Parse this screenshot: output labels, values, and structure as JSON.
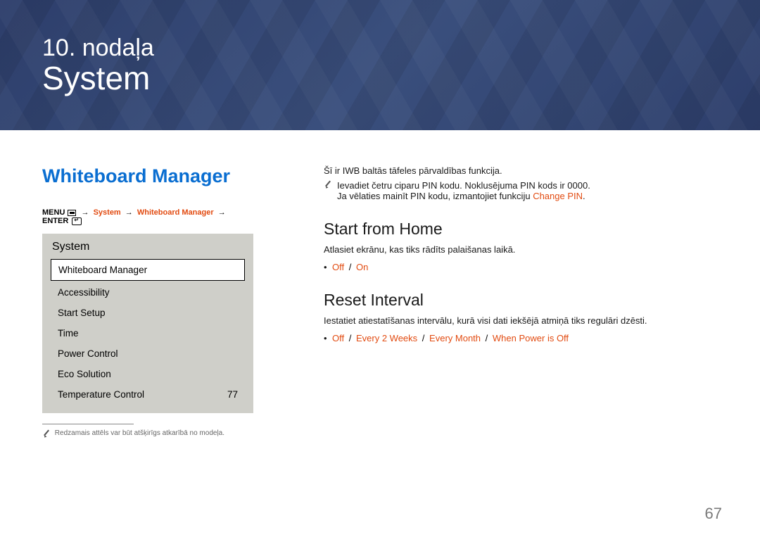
{
  "header": {
    "chapter_num": "10. nodaļa",
    "chapter_title": "System"
  },
  "left": {
    "section_title": "Whiteboard Manager",
    "breadcrumb": {
      "menu_label": "MENU",
      "seg1": "System",
      "seg2": "Whiteboard Manager",
      "enter_label": "ENTER"
    },
    "menu": {
      "header": "System",
      "items": [
        {
          "label": "Whiteboard Manager",
          "value": "",
          "selected": true
        },
        {
          "label": "Accessibility",
          "value": ""
        },
        {
          "label": "Start Setup",
          "value": ""
        },
        {
          "label": "Time",
          "value": ""
        },
        {
          "label": "Power Control",
          "value": ""
        },
        {
          "label": "Eco Solution",
          "value": ""
        },
        {
          "label": "Temperature Control",
          "value": "77"
        }
      ]
    },
    "footnote": "Redzamais attēls var būt atšķirīgs atkarībā no modeļa."
  },
  "right": {
    "intro": "Šī ir IWB baltās tāfeles pārvaldības funkcija.",
    "note_line1": "Ievadiet četru ciparu PIN kodu. Noklusējuma PIN kods ir 0000.",
    "note_line2_pre": "Ja vēlaties mainīt PIN kodu, izmantojiet funkciju ",
    "note_line2_em": "Change PIN",
    "note_line2_post": ".",
    "sub1": {
      "title": "Start from Home",
      "desc": "Atlasiet ekrānu, kas tiks rādīts palaišanas laikā.",
      "options": [
        "Off",
        "On"
      ]
    },
    "sub2": {
      "title": "Reset Interval",
      "desc": "Iestatiet atiestatīšanas intervālu, kurā visi dati iekšējā atmiņā tiks regulāri dzēsti.",
      "options": [
        "Off",
        "Every 2 Weeks",
        "Every Month",
        "When Power is Off"
      ]
    }
  },
  "page_number": "67"
}
